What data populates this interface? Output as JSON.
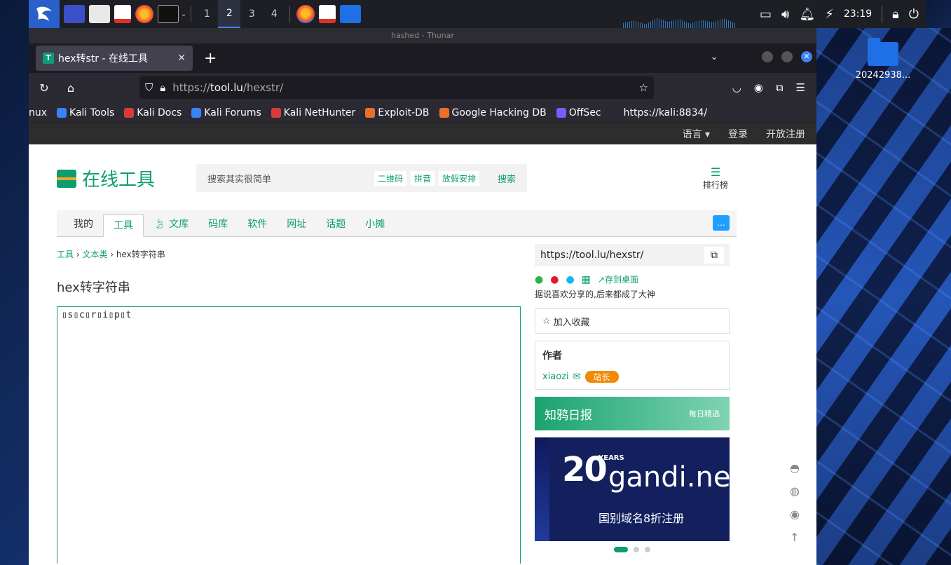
{
  "panel": {
    "workspaces": [
      "1",
      "2",
      "3",
      "4"
    ],
    "active_workspace": "2",
    "clock": "23:19"
  },
  "thunar_title": "hashed - Thunar",
  "desktop_icon_label": "20242938...",
  "browser": {
    "tab_title": "hex转str - 在线工具",
    "tab_favicon": "T",
    "url_scheme": "https://",
    "url_host": "tool.lu",
    "url_path": "/hexstr/",
    "bookmarks": [
      {
        "label": "nux",
        "color": "#2b2a33"
      },
      {
        "label": "Kali Tools",
        "color": "#3b82f6"
      },
      {
        "label": "Kali Docs",
        "color": "#d83b3b"
      },
      {
        "label": "Kali Forums",
        "color": "#3b82f6"
      },
      {
        "label": "Kali NetHunter",
        "color": "#d83b3b"
      },
      {
        "label": "Exploit-DB",
        "color": "#e8702a"
      },
      {
        "label": "Google Hacking DB",
        "color": "#e8702a"
      },
      {
        "label": "OffSec",
        "color": "#7b5cff"
      },
      {
        "label": "https://kali:8834/",
        "color": "#2b2a33"
      }
    ]
  },
  "site": {
    "topbar": {
      "language": "语言 ▾",
      "login": "登录",
      "register": "开放注册"
    },
    "logo": "在线工具",
    "search": {
      "placeholder": "搜索其实很简单",
      "chips": [
        "二维码",
        "拼音",
        "放假安排"
      ],
      "button": "搜索"
    },
    "rank_label": "排行榜",
    "menu": [
      "我的",
      "工具",
      "文库",
      "码库",
      "软件",
      "网址",
      "话题",
      "小摊"
    ],
    "breadcrumb": {
      "a": "工具",
      "b": "文本类",
      "current": "hex转字符串"
    },
    "heading": "hex转字符串",
    "editor_content": "\u0000s\u0000c\u0000r\u0000i\u0000p\u0000t",
    "editor_display": "▯s▯c▯r▯i▯p▯t",
    "share_url": "https://tool.lu/hexstr/",
    "save_desktop": "存到桌面",
    "tagline": "据说喜欢分享的,后来都成了大神",
    "fav_label": "加入收藏",
    "author": {
      "title": "作者",
      "name": "xiaozi",
      "badge": "站长"
    },
    "daily": {
      "title": "知鸦日报",
      "more": "每日精选"
    },
    "ad": {
      "years": "YEARS",
      "brand": "gandi.net",
      "text": "国别域名8折注册",
      "number": "20"
    }
  },
  "colors": {
    "accent": "#0c9d72",
    "badge": "#f08a00",
    "panel": "#1d1f24"
  }
}
